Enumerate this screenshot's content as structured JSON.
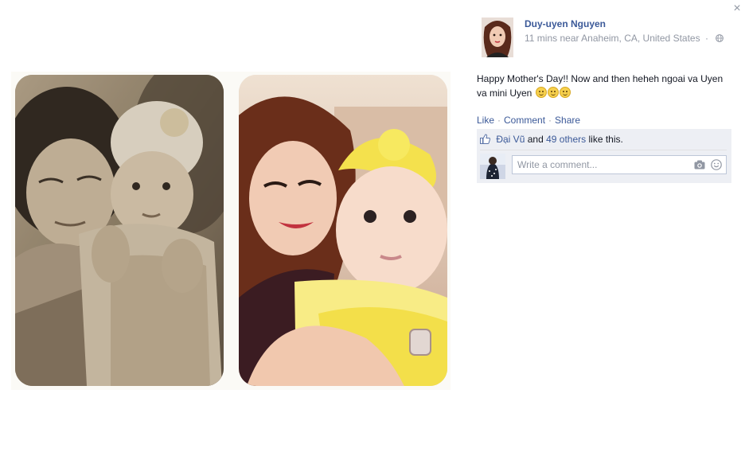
{
  "post": {
    "author": "Duy-uyen Nguyen",
    "time": "11 mins",
    "location": "near Anaheim, CA, United States",
    "separator": "·",
    "text": "Happy Mother's Day!! Now and then heheh ngoai va Uyen va mini Uyen",
    "emoji_count": 3
  },
  "actions": {
    "like": "Like",
    "comment": "Comment",
    "share": "Share",
    "separator": "·"
  },
  "likes": {
    "first_name": "Đại Vũ",
    "connector": "and",
    "others": "49 others",
    "suffix": "like this."
  },
  "comment": {
    "placeholder": "Write a comment..."
  },
  "close": {
    "label": "×"
  },
  "icons": {
    "close": "close-icon",
    "globe": "globe-icon",
    "like": "thumbs-up-icon",
    "camera": "camera-icon",
    "emoji": "smile-icon"
  },
  "colors": {
    "link": "#3b5998",
    "meta": "#9197a3",
    "ufi_background": "#edeff4"
  }
}
